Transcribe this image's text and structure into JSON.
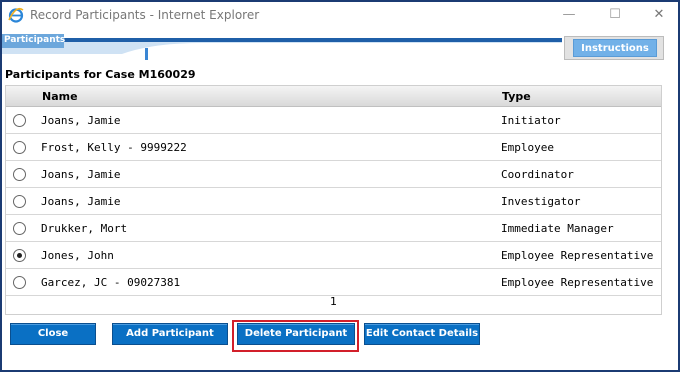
{
  "window": {
    "title": "Record Participants - Internet Explorer",
    "min_glyph": "—",
    "max_glyph": "☐",
    "close_glyph": "✕"
  },
  "header": {
    "tab_label": "Participants",
    "instructions_label": "Instructions"
  },
  "case_title": "Participants for Case M160029",
  "table": {
    "columns": [
      "Name",
      "Type"
    ],
    "rows": [
      {
        "name": "Joans, Jamie",
        "type": "Initiator",
        "selected": false
      },
      {
        "name": "Frost, Kelly - 9999222",
        "type": "Employee",
        "selected": false
      },
      {
        "name": "Joans, Jamie",
        "type": "Coordinator",
        "selected": false
      },
      {
        "name": "Joans, Jamie",
        "type": "Investigator",
        "selected": false
      },
      {
        "name": "Drukker, Mort",
        "type": "Immediate Manager",
        "selected": false
      },
      {
        "name": "Jones, John",
        "type": "Employee Representative",
        "selected": true
      },
      {
        "name": "Garcez, JC - 09027381",
        "type": "Employee Representative",
        "selected": false
      }
    ],
    "page": "1"
  },
  "buttons": {
    "close": "Close",
    "add": "Add Participant",
    "delete": "Delete Participant",
    "edit": "Edit Contact Details"
  },
  "colors": {
    "accent": "#0a70c4",
    "highlight": "#d21f2a",
    "band": "#1f5fa8"
  }
}
